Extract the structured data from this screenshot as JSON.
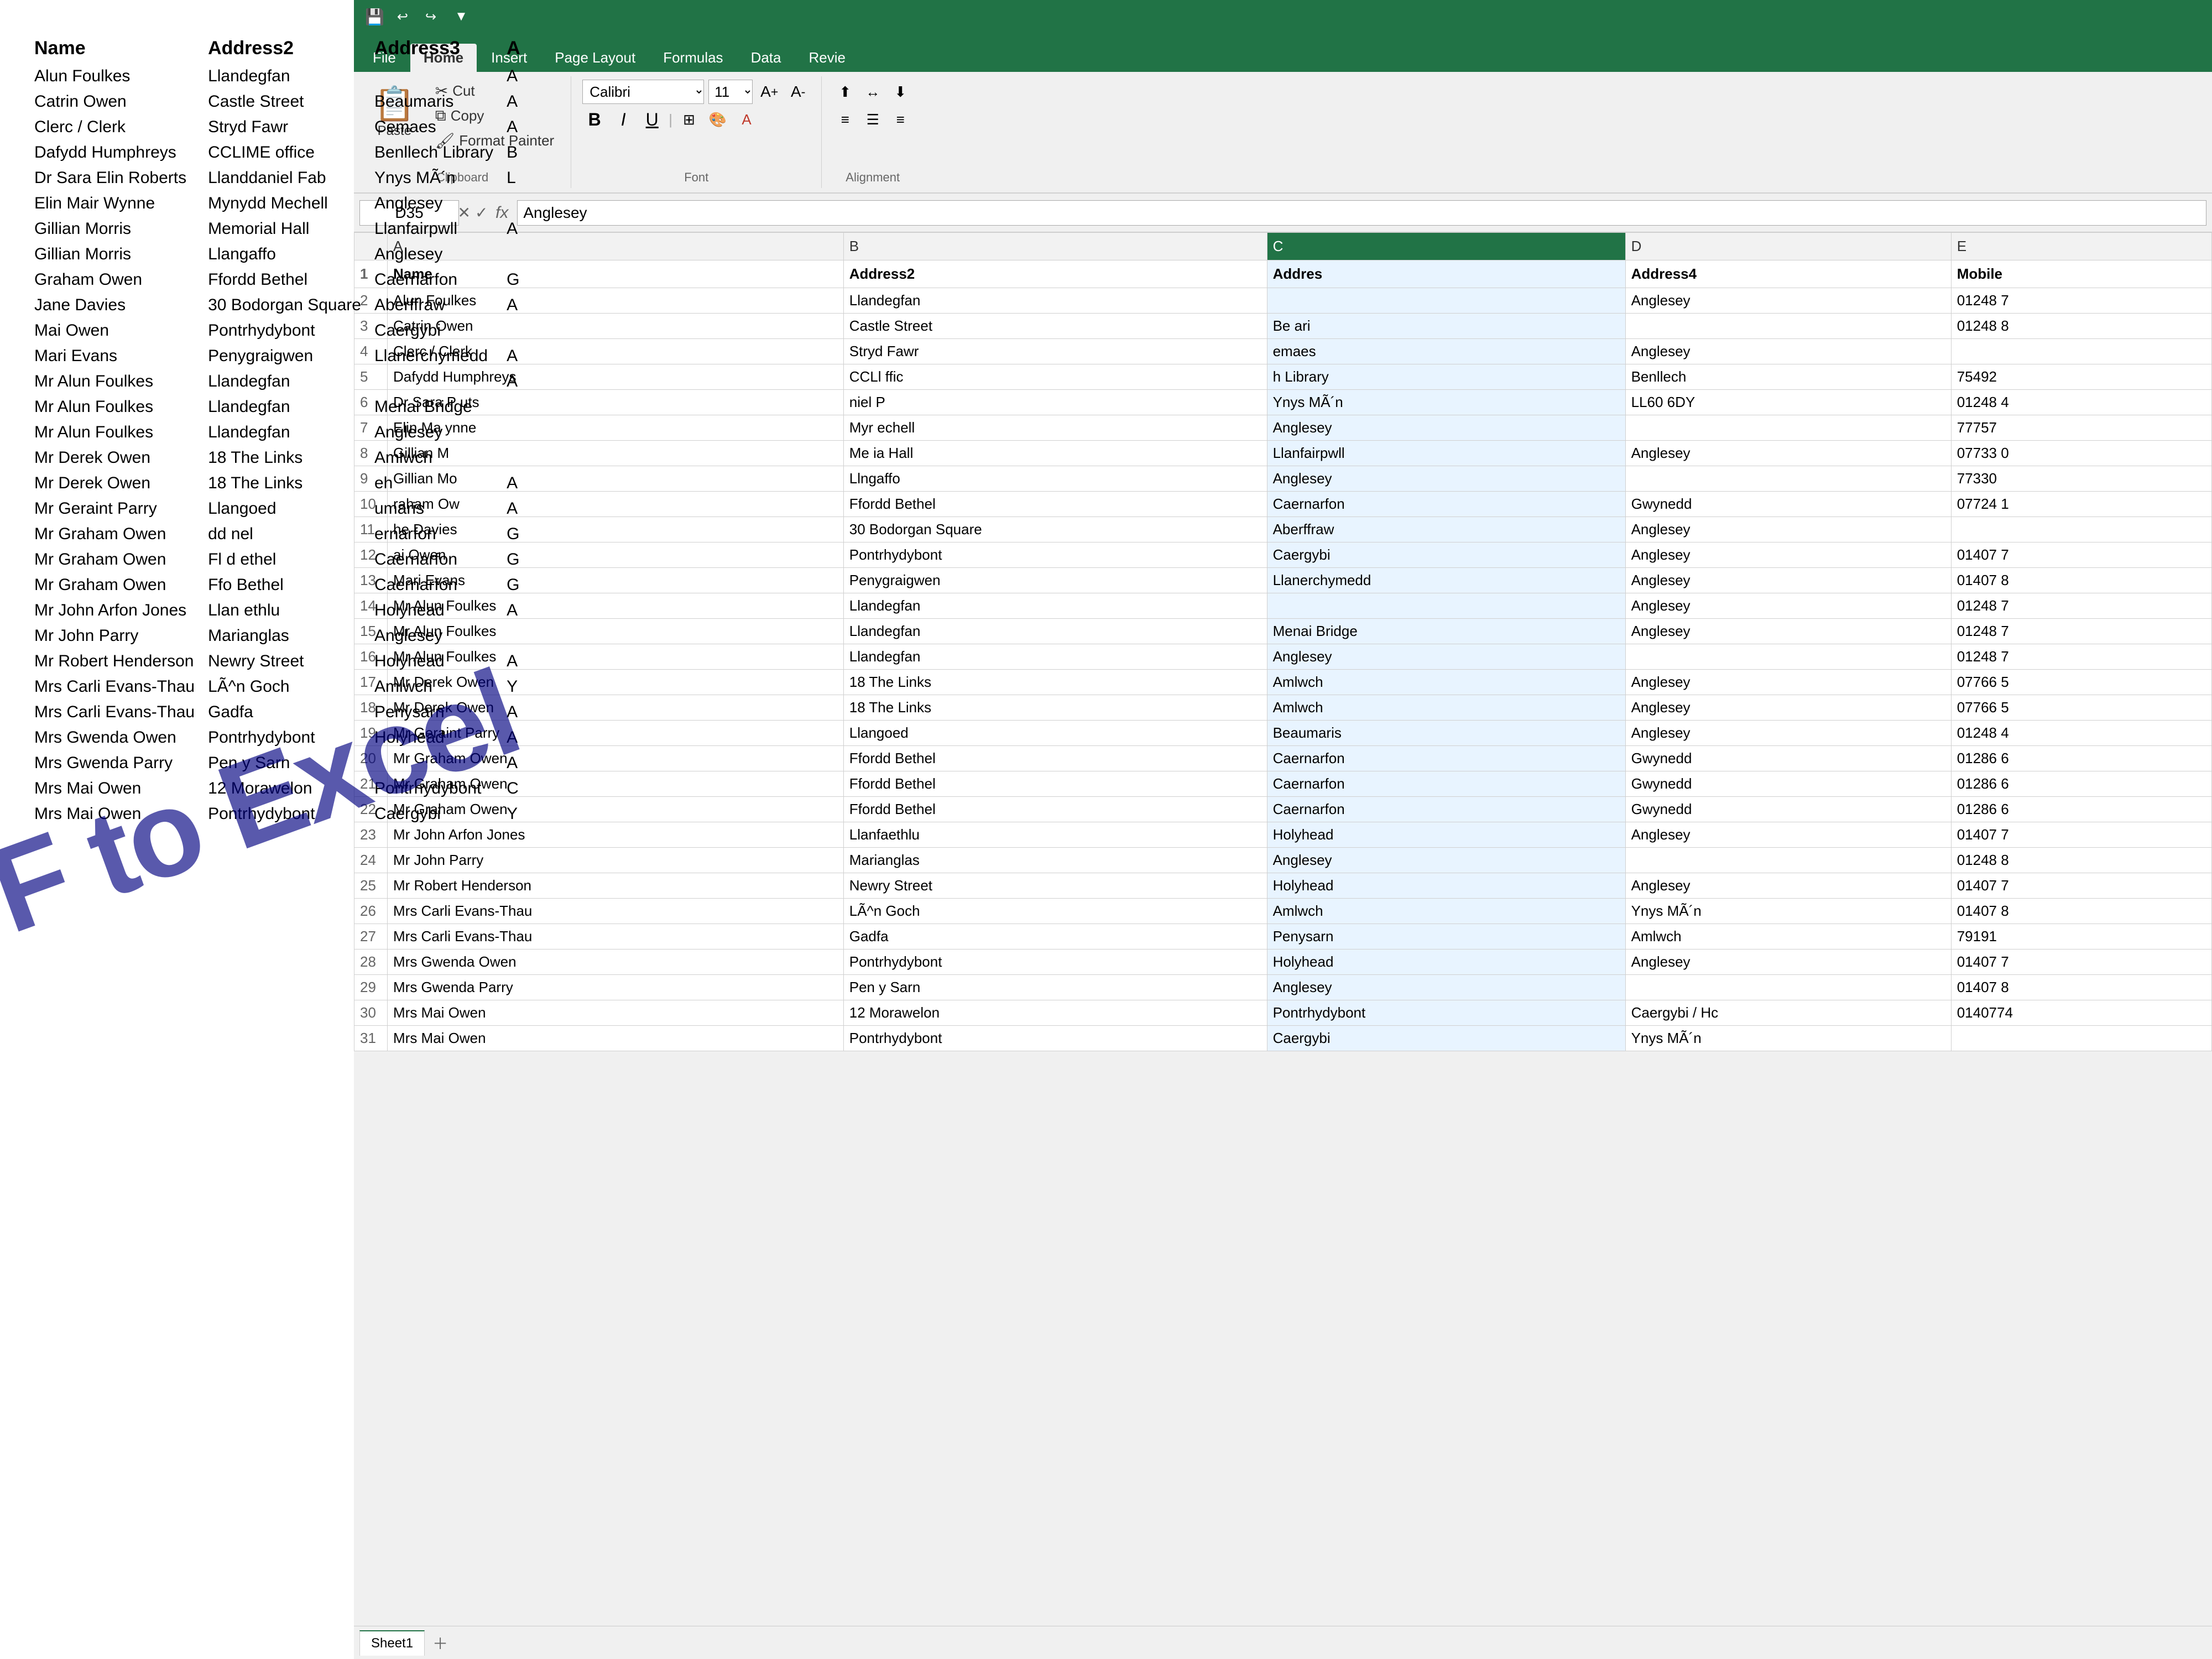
{
  "pdf": {
    "watermark": "PDF to Excel",
    "table": {
      "headers": [
        "Name",
        "Address2",
        "Address3",
        "A"
      ],
      "rows": [
        [
          "Alun Foulkes",
          "Llandegfan",
          "",
          "A"
        ],
        [
          "Catrin Owen",
          "Castle Street",
          "Beaumaris",
          "A"
        ],
        [
          "Clerc / Clerk",
          "Stryd Fawr",
          "Cemaes",
          "A"
        ],
        [
          "Dafydd Humphreys",
          "CCLIME office",
          "Benllech Library",
          "B"
        ],
        [
          "Dr Sara Elin Roberts",
          "Llanddaniel Fab",
          "Ynys MÃ´n",
          "L"
        ],
        [
          "Elin Mair Wynne",
          "Mynydd Mechell",
          "Anglesey",
          ""
        ],
        [
          "Gillian Morris",
          "Memorial Hall",
          "Llanfairpwll",
          "A"
        ],
        [
          "Gillian Morris",
          "Llangaffo",
          "Anglesey",
          ""
        ],
        [
          "Graham Owen",
          "Ffordd Bethel",
          "Caernarfon",
          "G"
        ],
        [
          "Jane Davies",
          "30 Bodorgan Square",
          "Aberffraw",
          "A"
        ],
        [
          "Mai Owen",
          "Pontrhydybont",
          "Caergybi",
          ""
        ],
        [
          "Mari Evans",
          "Penygraigwen",
          "Llanerchymedd",
          "A"
        ],
        [
          "Mr Alun Foulkes",
          "Llandegfan",
          "",
          "A"
        ],
        [
          "Mr Alun Foulkes",
          "Llandegfan",
          "Menai Bridge",
          ""
        ],
        [
          "Mr Alun Foulkes",
          "Llandegfan",
          "Anglesey",
          ""
        ],
        [
          "Mr Derek Owen",
          "18 The Links",
          "Amlwch",
          ""
        ],
        [
          "Mr Derek Owen",
          "18 The Links",
          "eh",
          "A"
        ],
        [
          "Mr Geraint Parry",
          "Llangoed",
          "umaris",
          "A"
        ],
        [
          "Mr Graham Owen",
          "dd nel",
          "ernarfon",
          "G"
        ],
        [
          "Mr Graham Owen",
          "Fl d ethel",
          "Caernarfon",
          "G"
        ],
        [
          "Mr Graham Owen",
          "Ffo Bethel",
          "Caernarfon",
          "G"
        ],
        [
          "Mr John Arfon Jones",
          "Llan ethlu",
          "Holyhead",
          "A"
        ],
        [
          "Mr John Parry",
          "Marianglas",
          "Anglesey",
          ""
        ],
        [
          "Mr Robert Henderson",
          "Newry Street",
          "Holyhead",
          "A"
        ],
        [
          "Mrs Carli Evans-Thau",
          "LÃ^n Goch",
          "Amlwch",
          "Y"
        ],
        [
          "Mrs Carli Evans-Thau",
          "Gadfa",
          "Penysarn",
          "A"
        ],
        [
          "Mrs Gwenda Owen",
          "Pontrhydybont",
          "Holyhead",
          "A"
        ],
        [
          "Mrs Gwenda Parry",
          "Pen y Sarn",
          "",
          "A"
        ],
        [
          "Mrs Mai Owen",
          "12 Morawelon",
          "Pontrhydybont",
          "C"
        ],
        [
          "Mrs Mai Owen",
          "Pontrhydybont",
          "Caergybi",
          "Y"
        ]
      ]
    }
  },
  "excel": {
    "title_bar": {
      "save_icon": "💾",
      "undo_icon": "↩",
      "redo_icon": "↪"
    },
    "ribbon": {
      "tabs": [
        "File",
        "Home",
        "Insert",
        "Page Layout",
        "Formulas",
        "Data",
        "Revie"
      ],
      "active_tab": "Home",
      "clipboard": {
        "label": "Clipboard",
        "cut_label": "Cut",
        "copy_label": "Copy",
        "paste_label": "Paste",
        "format_painter_label": "Format Painter"
      },
      "font": {
        "label": "Font",
        "name": "Calibri",
        "size": "11",
        "bold_label": "B",
        "italic_label": "I",
        "underline_label": "U"
      }
    },
    "formula_bar": {
      "cell_ref": "D35",
      "formula": "Anglesey"
    },
    "columns": [
      "",
      "A",
      "B",
      "C",
      "D",
      "E"
    ],
    "col_labels": {
      "A": "Name",
      "B": "Address2",
      "C": "Address3 (Addres)",
      "D": "Address4",
      "E": "Mobile"
    },
    "rows": [
      {
        "num": 1,
        "a": "Name",
        "b": "Address2",
        "c": "Addres",
        "d": "Address4",
        "e": "Mobile"
      },
      {
        "num": 2,
        "a": "Alun Foulkes",
        "b": "Llandegfan",
        "c": "",
        "d": "Anglesey",
        "e": "01248 7"
      },
      {
        "num": 3,
        "a": "Catrin Owen",
        "b": "Castle Street",
        "c": "Be ari",
        "d": "",
        "e": "01248 8"
      },
      {
        "num": 4,
        "a": "Clerc / Clerk",
        "b": "Stryd Fawr",
        "c": "emaes",
        "d": "Anglesey",
        "e": ""
      },
      {
        "num": 5,
        "a": "Dafydd Humphreys",
        "b": "CCLl ffic",
        "c": "h Library",
        "d": "Benllech",
        "e": "75492"
      },
      {
        "num": 6,
        "a": "Dr Sara P uts",
        "b": "niel P",
        "c": "Ynys MÃ´n",
        "d": "LL60 6DY",
        "e": "01248 4"
      },
      {
        "num": 7,
        "a": "Elin Ma ynne",
        "b": "Myr echell",
        "c": "Anglesey",
        "d": "",
        "e": "77757"
      },
      {
        "num": 8,
        "a": "Gillian M",
        "b": "Me ia Hall",
        "c": "Llanfairpwll",
        "d": "Anglesey",
        "e": "07733 0"
      },
      {
        "num": 9,
        "a": "Gillian Mo",
        "b": "Llngaffo",
        "c": "Anglesey",
        "d": "",
        "e": "77330"
      },
      {
        "num": 10,
        "a": "raham Ow",
        "b": "Ffordd Bethel",
        "c": "Caernarfon",
        "d": "Gwynedd",
        "e": "07724 1"
      },
      {
        "num": 11,
        "a": "he Davies",
        "b": "30 Bodorgan Square",
        "c": "Aberffraw",
        "d": "Anglesey",
        "e": ""
      },
      {
        "num": 12,
        "a": "ai Owen",
        "b": "Pontrhydybont",
        "c": "Caergybi",
        "d": "Anglesey",
        "e": "01407 7"
      },
      {
        "num": 13,
        "a": "Mari Evans",
        "b": "Penygraigwen",
        "c": "Llanerchymedd",
        "d": "Anglesey",
        "e": "01407 8"
      },
      {
        "num": 14,
        "a": "Mr Alun Foulkes",
        "b": "Llandegfan",
        "c": "",
        "d": "Anglesey",
        "e": "01248 7"
      },
      {
        "num": 15,
        "a": "Mr Alun Foulkes",
        "b": "Llandegfan",
        "c": "Menai Bridge",
        "d": "Anglesey",
        "e": "01248 7"
      },
      {
        "num": 16,
        "a": "Mr Alun Foulkes",
        "b": "Llandegfan",
        "c": "Anglesey",
        "d": "",
        "e": "01248 7"
      },
      {
        "num": 17,
        "a": "Mr Derek Owen",
        "b": "18 The Links",
        "c": "Amlwch",
        "d": "Anglesey",
        "e": "07766 5"
      },
      {
        "num": 18,
        "a": "Mr Derek Owen",
        "b": "18 The Links",
        "c": "Amlwch",
        "d": "Anglesey",
        "e": "07766 5"
      },
      {
        "num": 19,
        "a": "Mr Geraint Parry",
        "b": "Llangoed",
        "c": "Beaumaris",
        "d": "Anglesey",
        "e": "01248 4"
      },
      {
        "num": 20,
        "a": "Mr Graham Owen",
        "b": "Ffordd Bethel",
        "c": "Caernarfon",
        "d": "Gwynedd",
        "e": "01286 6"
      },
      {
        "num": 21,
        "a": "Mr Graham Owen",
        "b": "Ffordd Bethel",
        "c": "Caernarfon",
        "d": "Gwynedd",
        "e": "01286 6"
      },
      {
        "num": 22,
        "a": "Mr Graham Owen",
        "b": "Ffordd Bethel",
        "c": "Caernarfon",
        "d": "Gwynedd",
        "e": "01286 6"
      },
      {
        "num": 23,
        "a": "Mr John Arfon Jones",
        "b": "Llanfaethlu",
        "c": "Holyhead",
        "d": "Anglesey",
        "e": "01407 7"
      },
      {
        "num": 24,
        "a": "Mr John Parry",
        "b": "Marianglas",
        "c": "Anglesey",
        "d": "",
        "e": "01248 8"
      },
      {
        "num": 25,
        "a": "Mr Robert Henderson",
        "b": "Newry Street",
        "c": "Holyhead",
        "d": "Anglesey",
        "e": "01407 7"
      },
      {
        "num": 26,
        "a": "Mrs Carli Evans-Thau",
        "b": "LÃ^n Goch",
        "c": "Amlwch",
        "d": "Ynys MÃ´n",
        "e": "01407 8"
      },
      {
        "num": 27,
        "a": "Mrs Carli Evans-Thau",
        "b": "Gadfa",
        "c": "Penysarn",
        "d": "Amlwch",
        "e": "79191"
      },
      {
        "num": 28,
        "a": "Mrs Gwenda Owen",
        "b": "Pontrhydybont",
        "c": "Holyhead",
        "d": "Anglesey",
        "e": "01407 7"
      },
      {
        "num": 29,
        "a": "Mrs Gwenda Parry",
        "b": "Pen y Sarn",
        "c": "Anglesey",
        "d": "",
        "e": "01407 8"
      },
      {
        "num": 30,
        "a": "Mrs Mai Owen",
        "b": "12 Morawelon",
        "c": "Pontrhydybont",
        "d": "Caergybi / Hc",
        "e": "0140774"
      },
      {
        "num": 31,
        "a": "Mrs Mai Owen",
        "b": "Pontrhydybont",
        "c": "Caergybi",
        "d": "Ynys MÃ´n",
        "e": ""
      }
    ],
    "sheet_tabs": [
      "Sheet1"
    ]
  }
}
